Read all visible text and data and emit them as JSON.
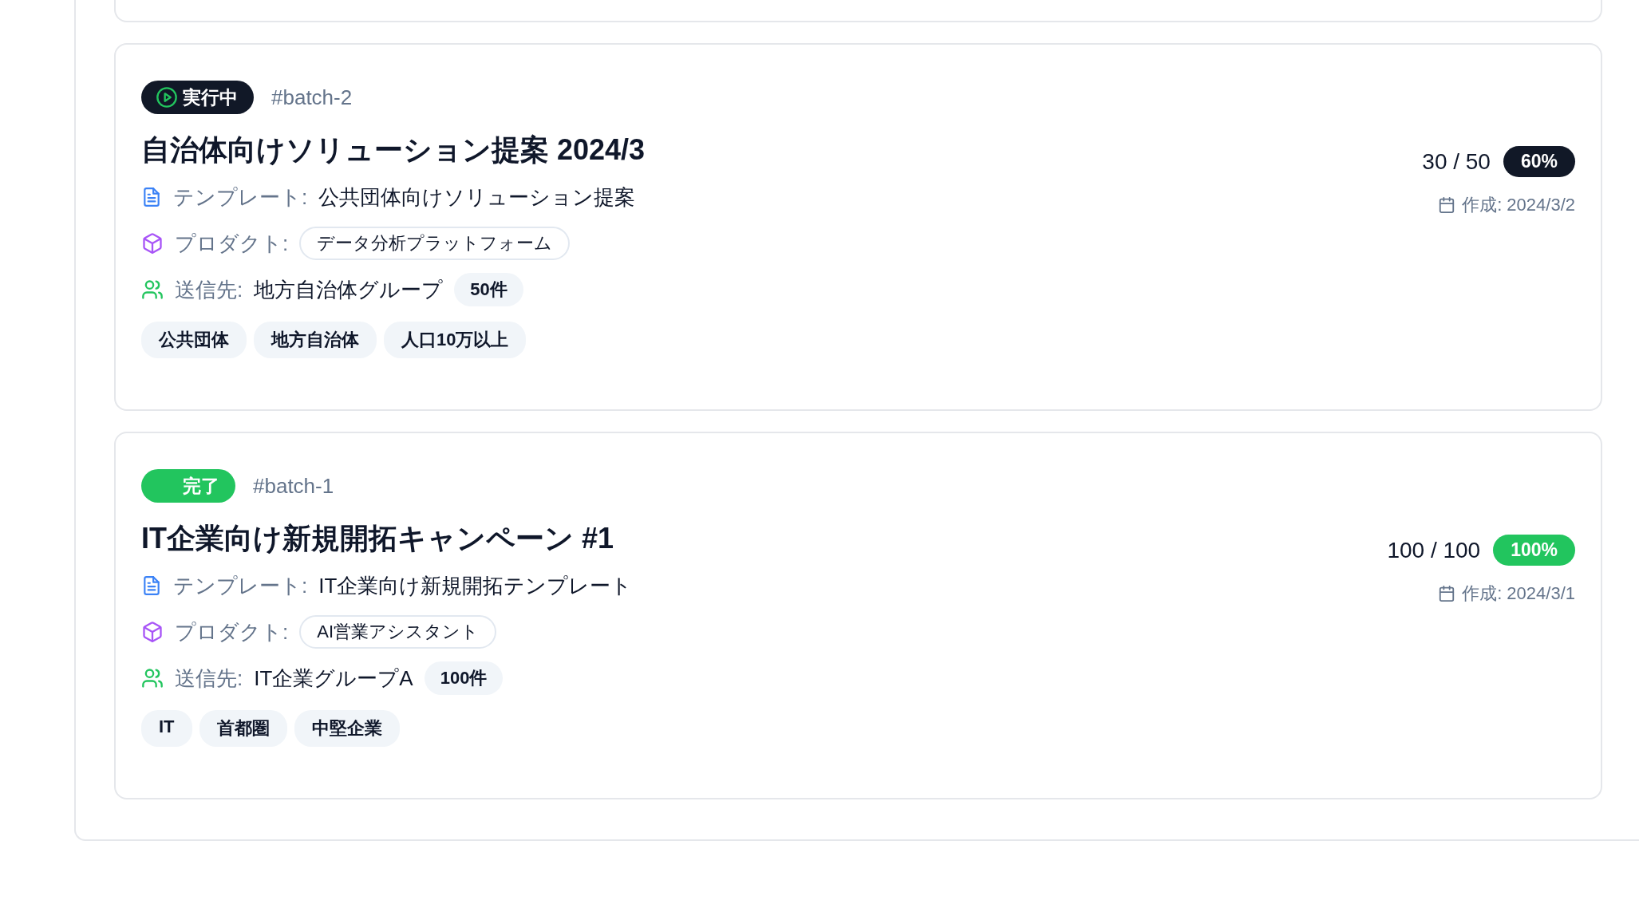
{
  "batches": [
    {
      "status": {
        "kind": "running",
        "label": "実行中"
      },
      "batch_id": "#batch-2",
      "title": "自治体向けソリューション提案 2024/3",
      "template_label": "テンプレート:",
      "template": "公共団体向けソリューション提案",
      "product_label": "プロダクト:",
      "product": "データ分析プラットフォーム",
      "recipients_label": "送信先:",
      "recipients": "地方自治体グループ",
      "count": "50件",
      "tags": [
        "公共団体",
        "地方自治体",
        "人口10万以上"
      ],
      "progress": "30 / 50",
      "percent": "60%",
      "created": "作成: 2024/3/2"
    },
    {
      "status": {
        "kind": "done",
        "label": "完了"
      },
      "batch_id": "#batch-1",
      "title": "IT企業向け新規開拓キャンペーン #1",
      "template_label": "テンプレート:",
      "template": "IT企業向け新規開拓テンプレート",
      "product_label": "プロダクト:",
      "product": "AI営業アシスタント",
      "recipients_label": "送信先:",
      "recipients": "IT企業グループA",
      "count": "100件",
      "tags": [
        "IT",
        "首都圏",
        "中堅企業"
      ],
      "progress": "100 / 100",
      "percent": "100%",
      "created": "作成: 2024/3/1"
    }
  ]
}
